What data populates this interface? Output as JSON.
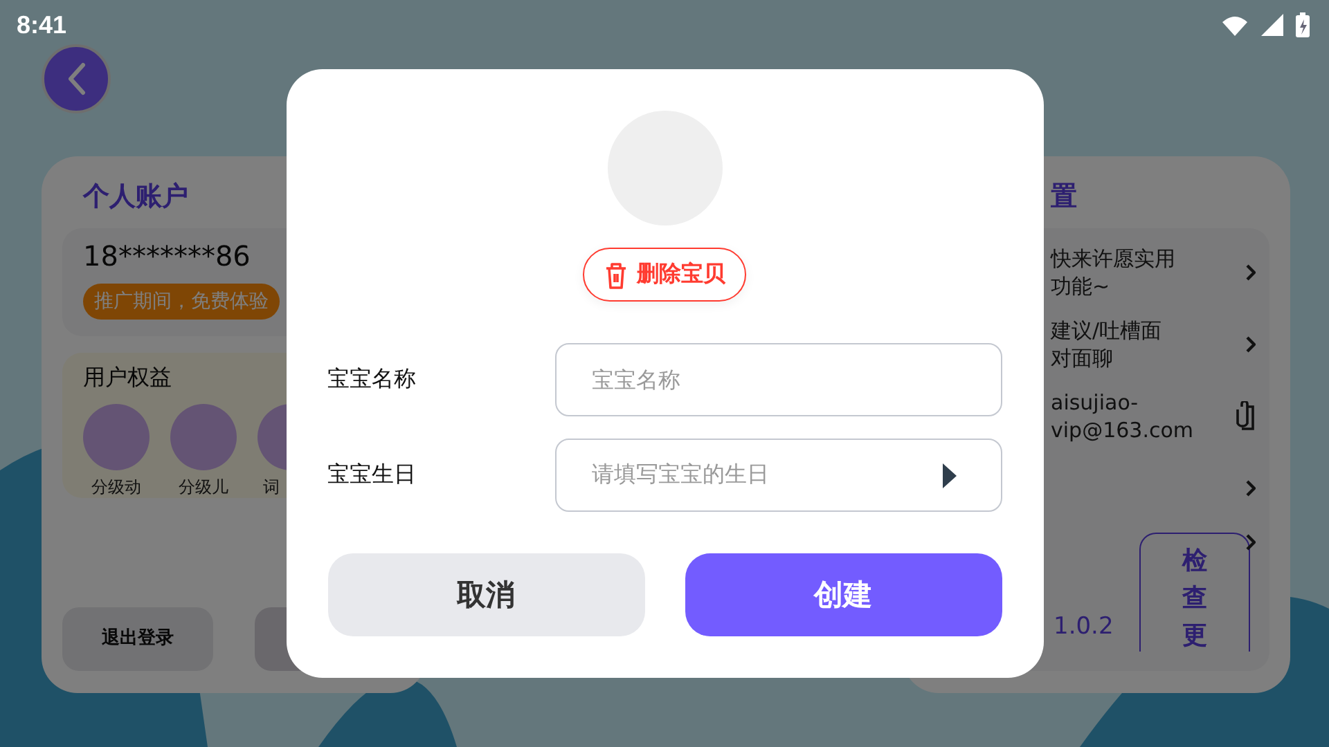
{
  "status_bar": {
    "time": "8:41"
  },
  "account_card": {
    "title": "个人账户",
    "phone": "18*******86",
    "promo_badge": "推广期间，免费体验",
    "benefits": {
      "title": "用户权益",
      "items": [
        {
          "label": "分级动"
        },
        {
          "label": "分级儿"
        },
        {
          "label": "词"
        }
      ]
    },
    "buttons": [
      {
        "label": "退出登录"
      },
      {
        "kind": "blank"
      }
    ]
  },
  "settings_card": {
    "title": "置",
    "items": [
      {
        "kind": "link",
        "label": "快来许愿实用功能~"
      },
      {
        "kind": "link",
        "label": "建议/吐槽面对面聊"
      },
      {
        "kind": "copy",
        "label": "aisujiao-vip@163.com"
      },
      {
        "kind": "link"
      },
      {
        "kind": "version",
        "label": "1.0.2",
        "button": "检查更"
      }
    ]
  },
  "dialog": {
    "delete_button": "删除宝贝",
    "fields": [
      {
        "kind": "text",
        "label": "宝宝名称",
        "placeholder": "宝宝名称"
      },
      {
        "kind": "picker",
        "label": "宝宝生日",
        "placeholder": "请填写宝宝的生日"
      }
    ],
    "buttons": [
      {
        "kind": "secondary",
        "label": "取消"
      },
      {
        "kind": "primary",
        "label": "创建"
      }
    ]
  }
}
